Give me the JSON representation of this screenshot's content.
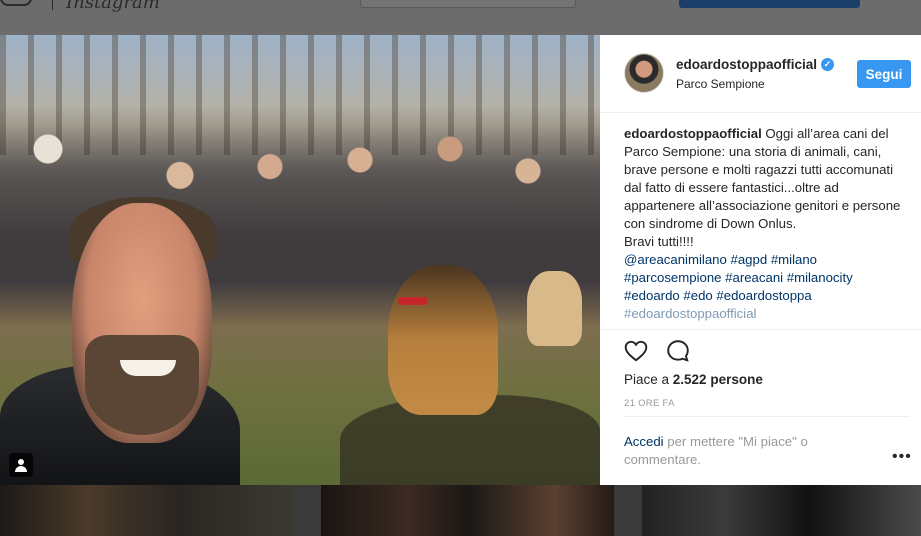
{
  "post": {
    "username": "edoardostoppaofficial",
    "location": "Parco Sempione",
    "follow_label": "Segui",
    "caption_user": "edoardostoppaofficial",
    "caption_text": "Oggi all’area cani del Parco Sempione: una storia di animali, cani, brave persone e molti ragazzi tutti accomunati dal fatto di essere fantastici...oltre ad appartenere all’associazione genitori e persone con sindrome di Down Onlus.",
    "caption_closing": "Bravi tutti!!!!",
    "caption_tags": "@areacanimilano #agpd #milano #parcosempione #areacani #milanocity #edoardo #edo #edoardostoppa",
    "caption_clipped": "#edoardostoppaofficial",
    "likes_prefix": "Piace a ",
    "likes_count": "2.522",
    "likes_suffix": " persone",
    "timestamp": "21 ORE FA",
    "login_link": "Accedi",
    "login_text": " per mettere \"Mi piace\" o commentare.",
    "more_label": "•••"
  },
  "icons": {
    "verified": "verified-badge-icon",
    "heart": "heart-icon",
    "comment": "comment-icon",
    "tag_people": "user-tag-icon",
    "more": "more-options-icon"
  },
  "colors": {
    "accent": "#3897f0",
    "link": "#003569",
    "text": "#262626",
    "muted": "#999999"
  }
}
